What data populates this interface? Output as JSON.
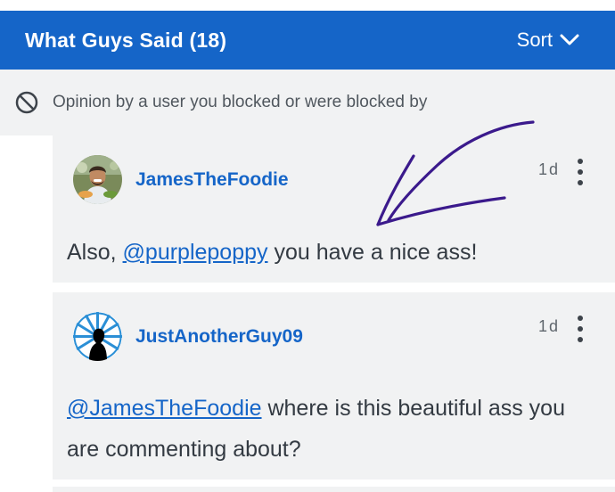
{
  "header": {
    "title": "What Guys Said (18)",
    "sort_label": "Sort"
  },
  "blocked_notice": {
    "text": "Opinion by a user you blocked or were blocked by"
  },
  "comments": [
    {
      "username": "JamesTheFoodie",
      "time": "1d",
      "text_before": "Also, ",
      "mention": "@purplepoppy",
      "text_after": " you have a nice ass!"
    },
    {
      "username": "JustAnotherGuy09",
      "time": "1d",
      "text_before": "",
      "mention": "@JamesTheFoodie",
      "text_after": " where is this beautiful ass you are commenting about?"
    }
  ],
  "colors": {
    "header_bg": "#1565c8",
    "link": "#1565c8",
    "card_bg": "#f1f2f3",
    "annotation": "#3b1a8c"
  },
  "icons": {
    "sort": "chevron-down-icon",
    "blocked": "blocked-icon",
    "menu": "more-vertical-icon"
  }
}
